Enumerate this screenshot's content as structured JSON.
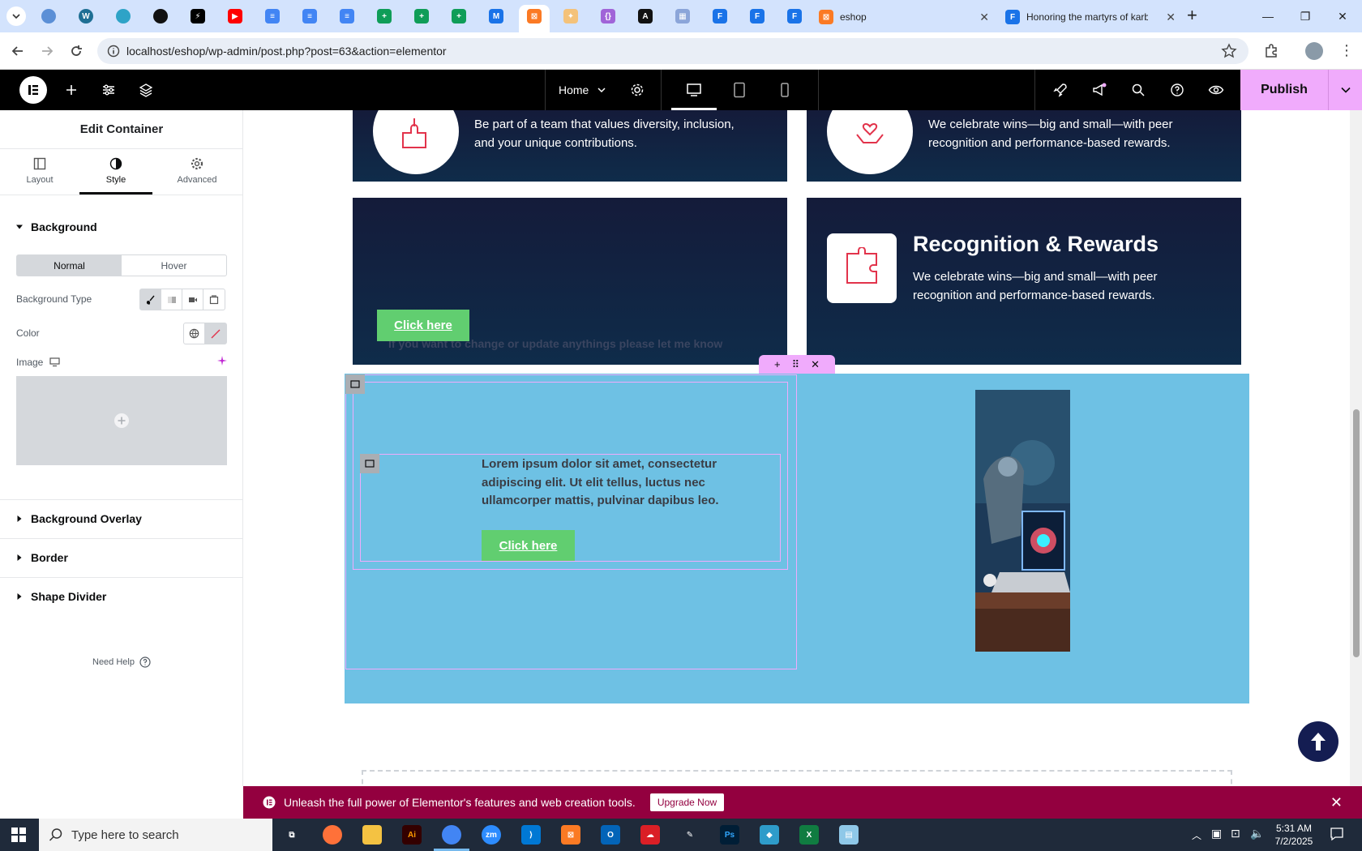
{
  "browser": {
    "tabs": [
      {
        "title": "eshop",
        "active": false
      },
      {
        "title": "Honoring the martyrs of karb",
        "active": false
      }
    ],
    "new_tab": "+",
    "url": "localhost/eshop/wp-admin/post.php?post=63&action=elementor"
  },
  "elementor_bar": {
    "page_name": "Home",
    "publish_label": "Publish"
  },
  "panel": {
    "title": "Edit Container",
    "tabs": [
      {
        "label": "Layout"
      },
      {
        "label": "Style"
      },
      {
        "label": "Advanced"
      }
    ],
    "background": {
      "heading": "Background",
      "state_normal": "Normal",
      "state_hover": "Hover",
      "type_label": "Background Type",
      "color_label": "Color",
      "image_label": "Image"
    },
    "sections": {
      "background_overlay": "Background Overlay",
      "border": "Border",
      "shape_divider": "Shape Divider"
    },
    "need_help": "Need Help"
  },
  "canvas": {
    "card1_text": "Be part of a team that values diversity, inclusion, and your unique contributions.",
    "card2_text": "We celebrate wins—big and small—with peer recognition and performance-based rewards.",
    "card3_faint": "If you want to change or update anythings please let me know",
    "card3_button": "Click here",
    "card4_title": "Recognition & Rewards",
    "card4_text": "We celebrate wins—big and small—with peer recognition and performance-based rewards.",
    "lorem": "Lorem ipsum dolor sit amet, consectetur adipiscing elit. Ut elit tellus, luctus nec ullamcorper mattis, pulvinar dapibus leo.",
    "lorem_button": "Click here"
  },
  "promo": {
    "text": "Unleash the full power of Elementor's features and web creation tools.",
    "button": "Upgrade Now"
  },
  "taskbar": {
    "search_placeholder": "Type here to search",
    "time": "5:31 AM",
    "date": "7/2/2025"
  },
  "colors": {
    "accent_pink": "#f0abfc",
    "card_navy": "#141b3a",
    "section_blue": "#6ec1e4",
    "button_green": "#61ce70",
    "promo_magenta": "#93003f"
  }
}
